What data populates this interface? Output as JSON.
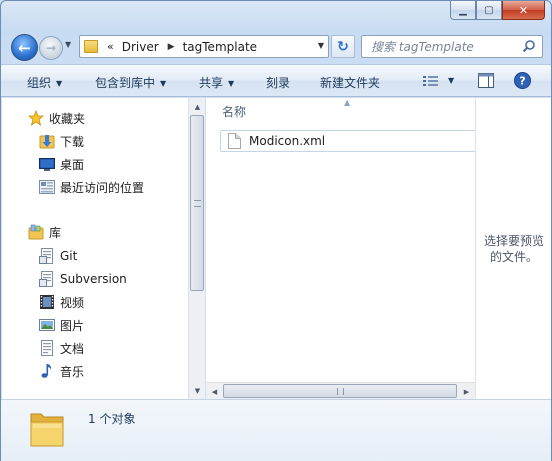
{
  "window": {
    "caption": {
      "minimize": "▁",
      "maximize": "▢",
      "close": "✕"
    }
  },
  "address": {
    "chevron": "«",
    "breadcrumb": [
      "Driver",
      "tagTemplate"
    ],
    "separator": "▶",
    "dropdown": "▼"
  },
  "search": {
    "placeholder": "搜索 tagTemplate"
  },
  "toolbar": {
    "organize": "组织",
    "include_in_library": "包含到库中",
    "share": "共享",
    "burn": "刻录",
    "new_folder": "新建文件夹",
    "arrow": "▼"
  },
  "nav": {
    "favorites": "收藏夹",
    "downloads": "下载",
    "desktop": "桌面",
    "recent": "最近访问的位置",
    "libraries": "库",
    "git": "Git",
    "subversion": "Subversion",
    "videos": "视频",
    "pictures": "图片",
    "documents": "文档",
    "music": "音乐"
  },
  "content": {
    "column_name": "名称",
    "files": [
      {
        "name": "Modicon.xml",
        "type": "xml"
      }
    ]
  },
  "preview": {
    "line1": "选择要预览",
    "line2": "的文件。"
  },
  "details": {
    "count_text": "1 个对象"
  },
  "colors": {
    "accent": "#2a6fcf",
    "selection_border": "#c4d5ea",
    "folder": "#f0c552"
  }
}
